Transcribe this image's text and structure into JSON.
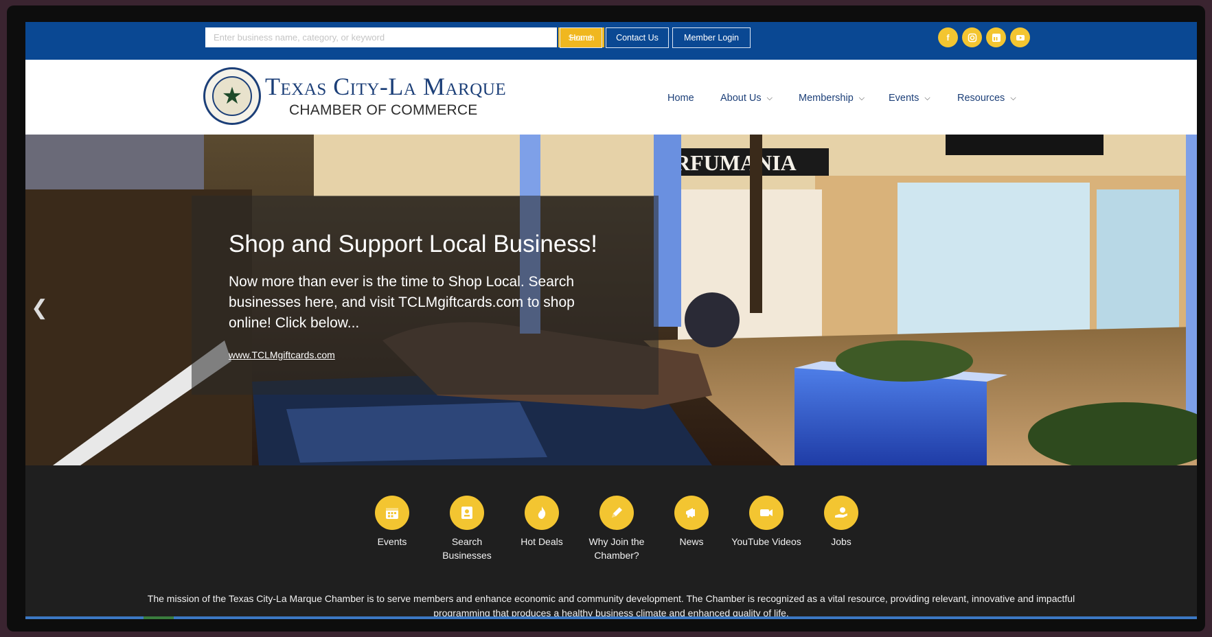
{
  "topbar": {
    "search_placeholder": "Enter business name, category, or keyword",
    "search_button": "Search",
    "links": [
      "Home",
      "Contact Us",
      "Member Login"
    ],
    "social_icons": [
      "facebook-icon",
      "instagram-icon",
      "linkedin-icon",
      "youtube-icon"
    ]
  },
  "header": {
    "logo_title": "Texas City-La Marque",
    "logo_subtitle": "CHAMBER OF COMMERCE",
    "nav": [
      {
        "label": "Home",
        "dropdown": false
      },
      {
        "label": "About Us",
        "dropdown": true
      },
      {
        "label": "Membership",
        "dropdown": true
      },
      {
        "label": "Events",
        "dropdown": true
      },
      {
        "label": "Resources",
        "dropdown": true
      }
    ]
  },
  "hero": {
    "title": "Shop and Support Local Business!",
    "body": "Now more than ever is the time to Shop Local. Search businesses here, and visit TCLMgiftcards.com to shop online! Click below...",
    "link": "www.TCLMgiftcards.com",
    "storefront_sign": "RFUMANIA"
  },
  "quick_links": [
    {
      "label": "Events",
      "icon": "calendar-icon"
    },
    {
      "label": "Search Businesses",
      "icon": "business-card-icon"
    },
    {
      "label": "Hot Deals",
      "icon": "flame-icon"
    },
    {
      "label": "Why Join the Chamber?",
      "icon": "pencil-icon"
    },
    {
      "label": "News",
      "icon": "megaphone-icon"
    },
    {
      "label": "YouTube Videos",
      "icon": "video-camera-icon"
    },
    {
      "label": "Jobs",
      "icon": "hand-money-icon"
    }
  ],
  "mission": "The mission of the Texas City-La Marque Chamber is to serve members and enhance economic and community development. The Chamber is recognized as a vital resource, providing relevant, innovative and impactful programming that produces a healthy business climate and enhanced quality of life.",
  "colors": {
    "topbar_blue": "#0a4893",
    "accent_yellow": "#f3c531",
    "footer_dark": "#1f1f1f",
    "brand_navy": "#1c3f78"
  }
}
